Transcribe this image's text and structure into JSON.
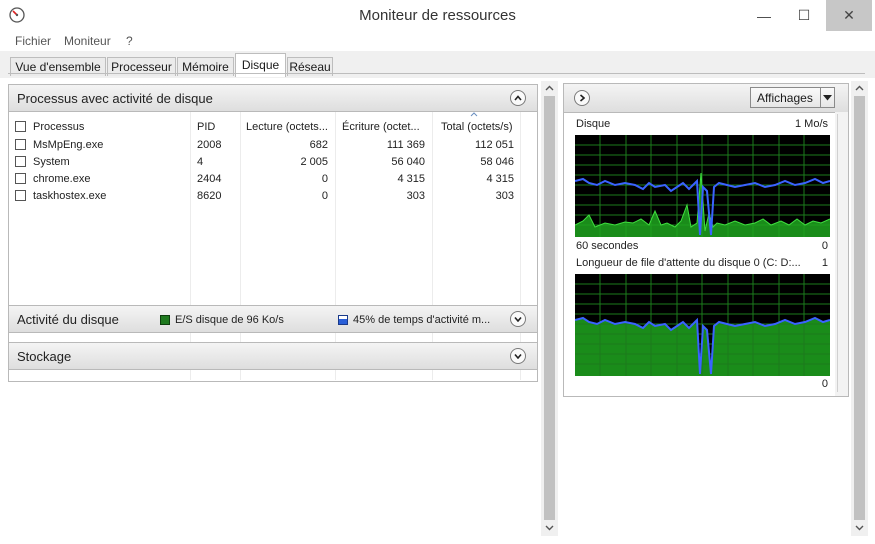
{
  "window": {
    "title": "Moniteur de ressources",
    "minimize": "—",
    "maximize": "☐",
    "close": "✕"
  },
  "menu": [
    "Fichier",
    "Moniteur",
    "?"
  ],
  "tabs": [
    {
      "label": "Vue d'ensemble",
      "active": false
    },
    {
      "label": "Processeur",
      "active": false
    },
    {
      "label": "Mémoire",
      "active": false
    },
    {
      "label": "Disque",
      "active": true
    },
    {
      "label": "Réseau",
      "active": false
    }
  ],
  "process_section": {
    "title": "Processus avec activité de disque",
    "columns": [
      "Processus",
      "PID",
      "Lecture (octets...",
      "Écriture (octet...",
      "Total (octets/s)"
    ],
    "rows": [
      {
        "name": "MsMpEng.exe",
        "pid": "2008",
        "read": "682",
        "write": "111 369",
        "total": "112 051"
      },
      {
        "name": "System",
        "pid": "4",
        "read": "2 005",
        "write": "56 040",
        "total": "58 046"
      },
      {
        "name": "chrome.exe",
        "pid": "2404",
        "read": "0",
        "write": "4 315",
        "total": "4 315"
      },
      {
        "name": "taskhostex.exe",
        "pid": "8620",
        "read": "0",
        "write": "303",
        "total": "303"
      }
    ]
  },
  "disk_activity": {
    "title": "Activité du disque",
    "io_text": "E/S disque de 96 Ko/s",
    "active_time_text": "45% de temps d'activité m...",
    "io_color": "#2a8a2a",
    "active_color": "#2a5fd8"
  },
  "storage": {
    "title": "Stockage"
  },
  "right_panel": {
    "view_button": "Affichages",
    "chart1": {
      "title": "Disque",
      "max_label": "1 Mo/s",
      "time_label": "60 secondes",
      "min_label": "0"
    },
    "chart2": {
      "title": "Longueur de file d'attente du disque 0 (C: D:...",
      "max_label": "1",
      "min_label": "0"
    }
  },
  "colors": {
    "graph_bg": "#000000",
    "grid": "#1c7a1c",
    "green_fill": "#1ea51e",
    "green_line": "#3fe03f",
    "blue_line": "#3a63ff"
  }
}
